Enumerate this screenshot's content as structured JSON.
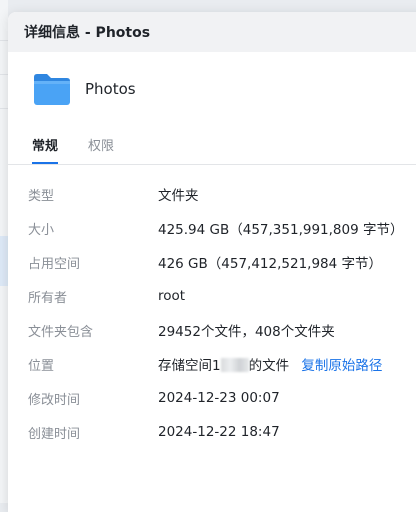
{
  "window": {
    "title": "详细信息 - Photos"
  },
  "item": {
    "name": "Photos",
    "icon": "folder-icon"
  },
  "tabs": [
    {
      "label": "常规",
      "active": true
    },
    {
      "label": "权限",
      "active": false
    }
  ],
  "properties": {
    "type": {
      "label": "类型",
      "value": "文件夹"
    },
    "size": {
      "label": "大小",
      "value": "425.94 GB（457,351,991,809 字节）"
    },
    "disk_usage": {
      "label": "占用空间",
      "value": "426 GB（457,412,521,984 字节）"
    },
    "owner": {
      "label": "所有者",
      "value": "root"
    },
    "contains": {
      "label": "文件夹包含",
      "value": "29452个文件，408个文件夹"
    },
    "location": {
      "label": "位置",
      "value_prefix": "存储空间1",
      "value_suffix": "的文件",
      "copy_link": "复制原始路径"
    },
    "modified": {
      "label": "修改时间",
      "value": "2024-12-23 00:07"
    },
    "created": {
      "label": "创建时间",
      "value": "2024-12-22 18:47"
    }
  },
  "colors": {
    "accent": "#1a73e8",
    "folder": "#3d9af0",
    "label_text": "#8a8f97"
  }
}
